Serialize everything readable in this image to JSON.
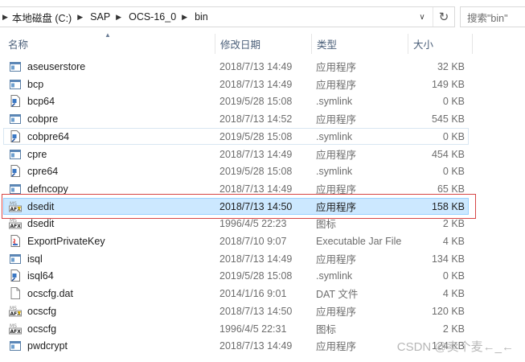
{
  "address": {
    "segments": [
      "本地磁盘 (C:)",
      "SAP",
      "OCS-16_0",
      "bin"
    ]
  },
  "search": {
    "placeholder": "搜索\"bin\""
  },
  "columns": {
    "name": "名称",
    "date": "修改日期",
    "type": "类型",
    "size": "大小"
  },
  "files": [
    {
      "name": "aseuserstore",
      "date": "2018/7/13 14:49",
      "type": "应用程序",
      "size": "32 KB",
      "icon": "exe-icon"
    },
    {
      "name": "bcp",
      "date": "2018/7/13 14:49",
      "type": "应用程序",
      "size": "149 KB",
      "icon": "exe-icon"
    },
    {
      "name": "bcp64",
      "date": "2019/5/28 15:08",
      "type": ".symlink",
      "size": "0 KB",
      "icon": "symlink-icon"
    },
    {
      "name": "cobpre",
      "date": "2018/7/13 14:52",
      "type": "应用程序",
      "size": "545 KB",
      "icon": "exe-icon"
    },
    {
      "name": "cobpre64",
      "date": "2019/5/28 15:08",
      "type": ".symlink",
      "size": "0 KB",
      "icon": "symlink-icon"
    },
    {
      "name": "cpre",
      "date": "2018/7/13 14:49",
      "type": "应用程序",
      "size": "454 KB",
      "icon": "exe-icon"
    },
    {
      "name": "cpre64",
      "date": "2019/5/28 15:08",
      "type": ".symlink",
      "size": "0 KB",
      "icon": "symlink-icon"
    },
    {
      "name": "defncopy",
      "date": "2018/7/13 14:49",
      "type": "应用程序",
      "size": "65 KB",
      "icon": "exe-icon"
    },
    {
      "name": "dsedit",
      "date": "2018/7/13 14:50",
      "type": "应用程序",
      "size": "158 KB",
      "icon": "afx-app-icon"
    },
    {
      "name": "dsedit",
      "date": "1996/4/5 22:23",
      "type": "图标",
      "size": "2 KB",
      "icon": "afx-ico-icon"
    },
    {
      "name": "ExportPrivateKey",
      "date": "2018/7/10 9:07",
      "type": "Executable Jar File",
      "size": "4 KB",
      "icon": "jar-icon"
    },
    {
      "name": "isql",
      "date": "2018/7/13 14:49",
      "type": "应用程序",
      "size": "134 KB",
      "icon": "exe-icon"
    },
    {
      "name": "isql64",
      "date": "2019/5/28 15:08",
      "type": ".symlink",
      "size": "0 KB",
      "icon": "symlink-icon"
    },
    {
      "name": "ocscfg.dat",
      "date": "2014/1/16 9:01",
      "type": "DAT 文件",
      "size": "4 KB",
      "icon": "blank-file-icon"
    },
    {
      "name": "ocscfg",
      "date": "2018/7/13 14:50",
      "type": "应用程序",
      "size": "120 KB",
      "icon": "afx-app-icon"
    },
    {
      "name": "ocscfg",
      "date": "1996/4/5 22:31",
      "type": "图标",
      "size": "2 KB",
      "icon": "afx-ico-icon"
    },
    {
      "name": "pwdcrypt",
      "date": "2018/7/13 14:49",
      "type": "应用程序",
      "size": "124 KB",
      "icon": "exe-icon"
    }
  ],
  "hover_index": 4,
  "selected_index": 8,
  "watermark": "CSDN @卖个麦←_←"
}
